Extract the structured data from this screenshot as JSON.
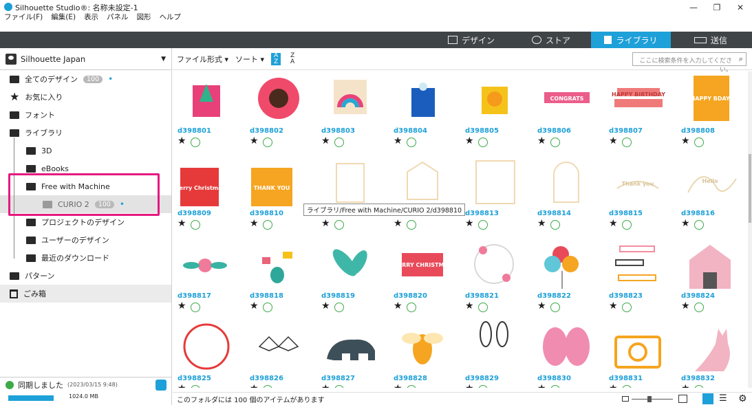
{
  "window": {
    "title": "Silhouette Studio®: 名称未設定-1",
    "menu": [
      "ファイル(F)",
      "編集(E)",
      "表示",
      "パネル",
      "図形",
      "ヘルプ"
    ],
    "controls": [
      "—",
      "❐",
      "✕"
    ]
  },
  "top_tabs": [
    {
      "label": "デザイン",
      "icon": "grid-icon",
      "active": false
    },
    {
      "label": "ストア",
      "icon": "silhouette-logo-icon",
      "active": false
    },
    {
      "label": "ライブラリ",
      "icon": "download-icon",
      "active": true
    },
    {
      "label": "送信",
      "icon": "cutter-icon",
      "active": false
    }
  ],
  "colors": {
    "accent": "#1ea0d8",
    "highlight_box": "#e5197f",
    "check": "#3caa48",
    "tabbar": "#3f4447"
  },
  "account": {
    "name": "Silhouette Japan"
  },
  "sidebar": {
    "items": [
      {
        "label": "全てのデザイン",
        "badge": "100",
        "icon": "folder-icon"
      },
      {
        "label": "お気に入り",
        "icon": "star-icon"
      },
      {
        "label": "フォント",
        "icon": "folder-icon"
      },
      {
        "label": "ライブラリ",
        "icon": "folder-open-icon"
      },
      {
        "label": "3D",
        "icon": "folder-icon"
      },
      {
        "label": "eBooks",
        "icon": "folder-icon"
      },
      {
        "label": "Free with Machine",
        "icon": "folder-open-icon"
      },
      {
        "label": "CURIO 2",
        "badge": "100",
        "icon": "folder-icon"
      },
      {
        "label": "プロジェクトのデザイン",
        "icon": "folder-open-icon"
      },
      {
        "label": "ユーザーのデザイン",
        "icon": "folder-open-icon"
      },
      {
        "label": "最近のダウンロード",
        "icon": "folder-icon"
      },
      {
        "label": "パターン",
        "icon": "folder-icon"
      },
      {
        "label": "ごみ箱",
        "icon": "trash-icon"
      }
    ],
    "sync": {
      "label": "同期しました",
      "time": "(2023/03/15 9:48)"
    },
    "storage": {
      "value": "1024.0 MB",
      "used_fraction": 0.3
    }
  },
  "toolbar": {
    "file_type": "ファイル形式",
    "sort": "ソート",
    "search_placeholder": "ここに検索条件を入力してください。"
  },
  "designs": [
    {
      "code": "d398801",
      "art": "card-tree"
    },
    {
      "code": "d398802",
      "art": "flower"
    },
    {
      "code": "d398803",
      "art": "rainbow"
    },
    {
      "code": "d398804",
      "art": "bag"
    },
    {
      "code": "d398805",
      "art": "sunbox"
    },
    {
      "code": "d398806",
      "art": "banner-congrats"
    },
    {
      "code": "d398807",
      "art": "banner-birthday"
    },
    {
      "code": "d398808",
      "art": "card-happy"
    },
    {
      "code": "d398809",
      "art": "card-christmas"
    },
    {
      "code": "d398810",
      "art": "card-thankyou"
    },
    {
      "code": "d398811",
      "art": "frame1"
    },
    {
      "code": "d398812",
      "art": "frame2"
    },
    {
      "code": "d398813",
      "art": "frame3"
    },
    {
      "code": "d398814",
      "art": "frame4"
    },
    {
      "code": "d398815",
      "art": "thankyou-script"
    },
    {
      "code": "d398816",
      "art": "hello-script"
    },
    {
      "code": "d398817",
      "art": "floral"
    },
    {
      "code": "d398818",
      "art": "plants"
    },
    {
      "code": "d398819",
      "art": "leaves"
    },
    {
      "code": "d398820",
      "art": "merry"
    },
    {
      "code": "d398821",
      "art": "wreath"
    },
    {
      "code": "d398822",
      "art": "balloons"
    },
    {
      "code": "d398823",
      "art": "ribbons"
    },
    {
      "code": "d398824",
      "art": "barn"
    },
    {
      "code": "d398825",
      "art": "baseball"
    },
    {
      "code": "d398826",
      "art": "bats"
    },
    {
      "code": "d398827",
      "art": "bear"
    },
    {
      "code": "d398828",
      "art": "bee"
    },
    {
      "code": "d398829",
      "art": "bunny"
    },
    {
      "code": "d398830",
      "art": "butterfly"
    },
    {
      "code": "d398831",
      "art": "camera"
    },
    {
      "code": "d398832",
      "art": "cat"
    }
  ],
  "thumb_text": {
    "card_happy": "HAPPY BDAY!",
    "card_christmas": "Merry Christmas",
    "card_thankyou": "THANK YOU",
    "banner_congrats": "CONGRATS",
    "banner_birthday": "HAPPY BIRTHDAY",
    "thankyou_script": "Thank you",
    "hello_script": "Hello",
    "merry": "MERRY CHRISTMAS"
  },
  "tooltip": "ライブラリ/Free with Machine/CURIO 2/d398810",
  "status": {
    "count_text": "このフォルダには 100 個のアイテムがあります"
  }
}
